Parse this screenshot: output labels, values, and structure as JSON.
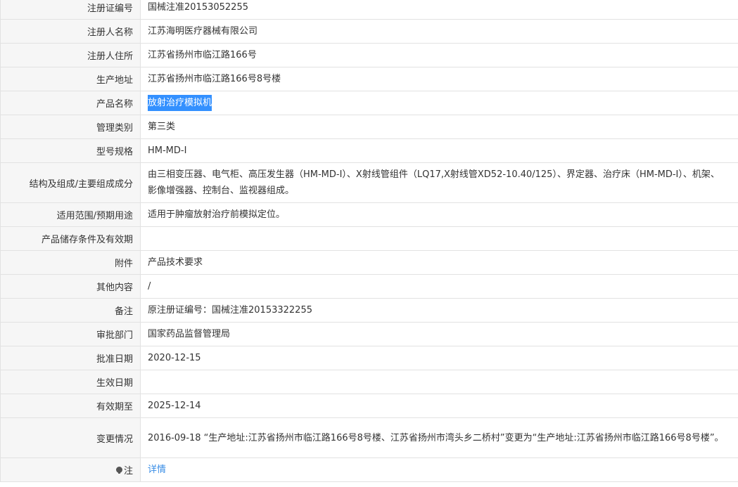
{
  "rows": [
    {
      "label": "注册证编号",
      "value": "国械注准20153052255"
    },
    {
      "label": "注册人名称",
      "value": "江苏海明医疗器械有限公司"
    },
    {
      "label": "注册人住所",
      "value": "江苏省扬州市临江路166号"
    },
    {
      "label": "生产地址",
      "value": "江苏省扬州市临江路166号8号楼"
    },
    {
      "label": "产品名称",
      "value": "放射治疗模拟机"
    },
    {
      "label": "管理类别",
      "value": "第三类"
    },
    {
      "label": "型号规格",
      "value": "HM-MD-I"
    },
    {
      "label": "结构及组成/主要组成成分",
      "value": "由三相变压器、电气柜、高压发生器（HM-MD-I）、X射线管组件（LQ17,X射线管XD52-10.40/125）、界定器、治疗床（HM-MD-I）、机架、影像增强器、控制台、监视器组成。"
    },
    {
      "label": "适用范围/预期用途",
      "value": "适用于肿瘤放射治疗前模拟定位。"
    },
    {
      "label": "产品储存条件及有效期",
      "value": ""
    },
    {
      "label": "附件",
      "value": "产品技术要求"
    },
    {
      "label": "其他内容",
      "value": "/"
    },
    {
      "label": "备注",
      "value": "原注册证编号：国械注准20153322255"
    },
    {
      "label": "审批部门",
      "value": "国家药品监督管理局"
    },
    {
      "label": "批准日期",
      "value": "2020-12-15"
    },
    {
      "label": "生效日期",
      "value": ""
    },
    {
      "label": "有效期至",
      "value": "2025-12-14"
    },
    {
      "label": "变更情况",
      "value": "2016-09-18 “生产地址:江苏省扬州市临江路166号8号楼、江苏省扬州市湾头乡二桥村”变更为“生产地址:江苏省扬州市临江路166号8号楼”。"
    },
    {
      "label": "注",
      "value": "详情"
    }
  ],
  "colors": {
    "label_bg": "#f6f6f6",
    "border": "#e2e2e2",
    "link": "#3a8ee6",
    "selection": "#3390ff"
  },
  "icons": {
    "note": "bulb-icon"
  }
}
